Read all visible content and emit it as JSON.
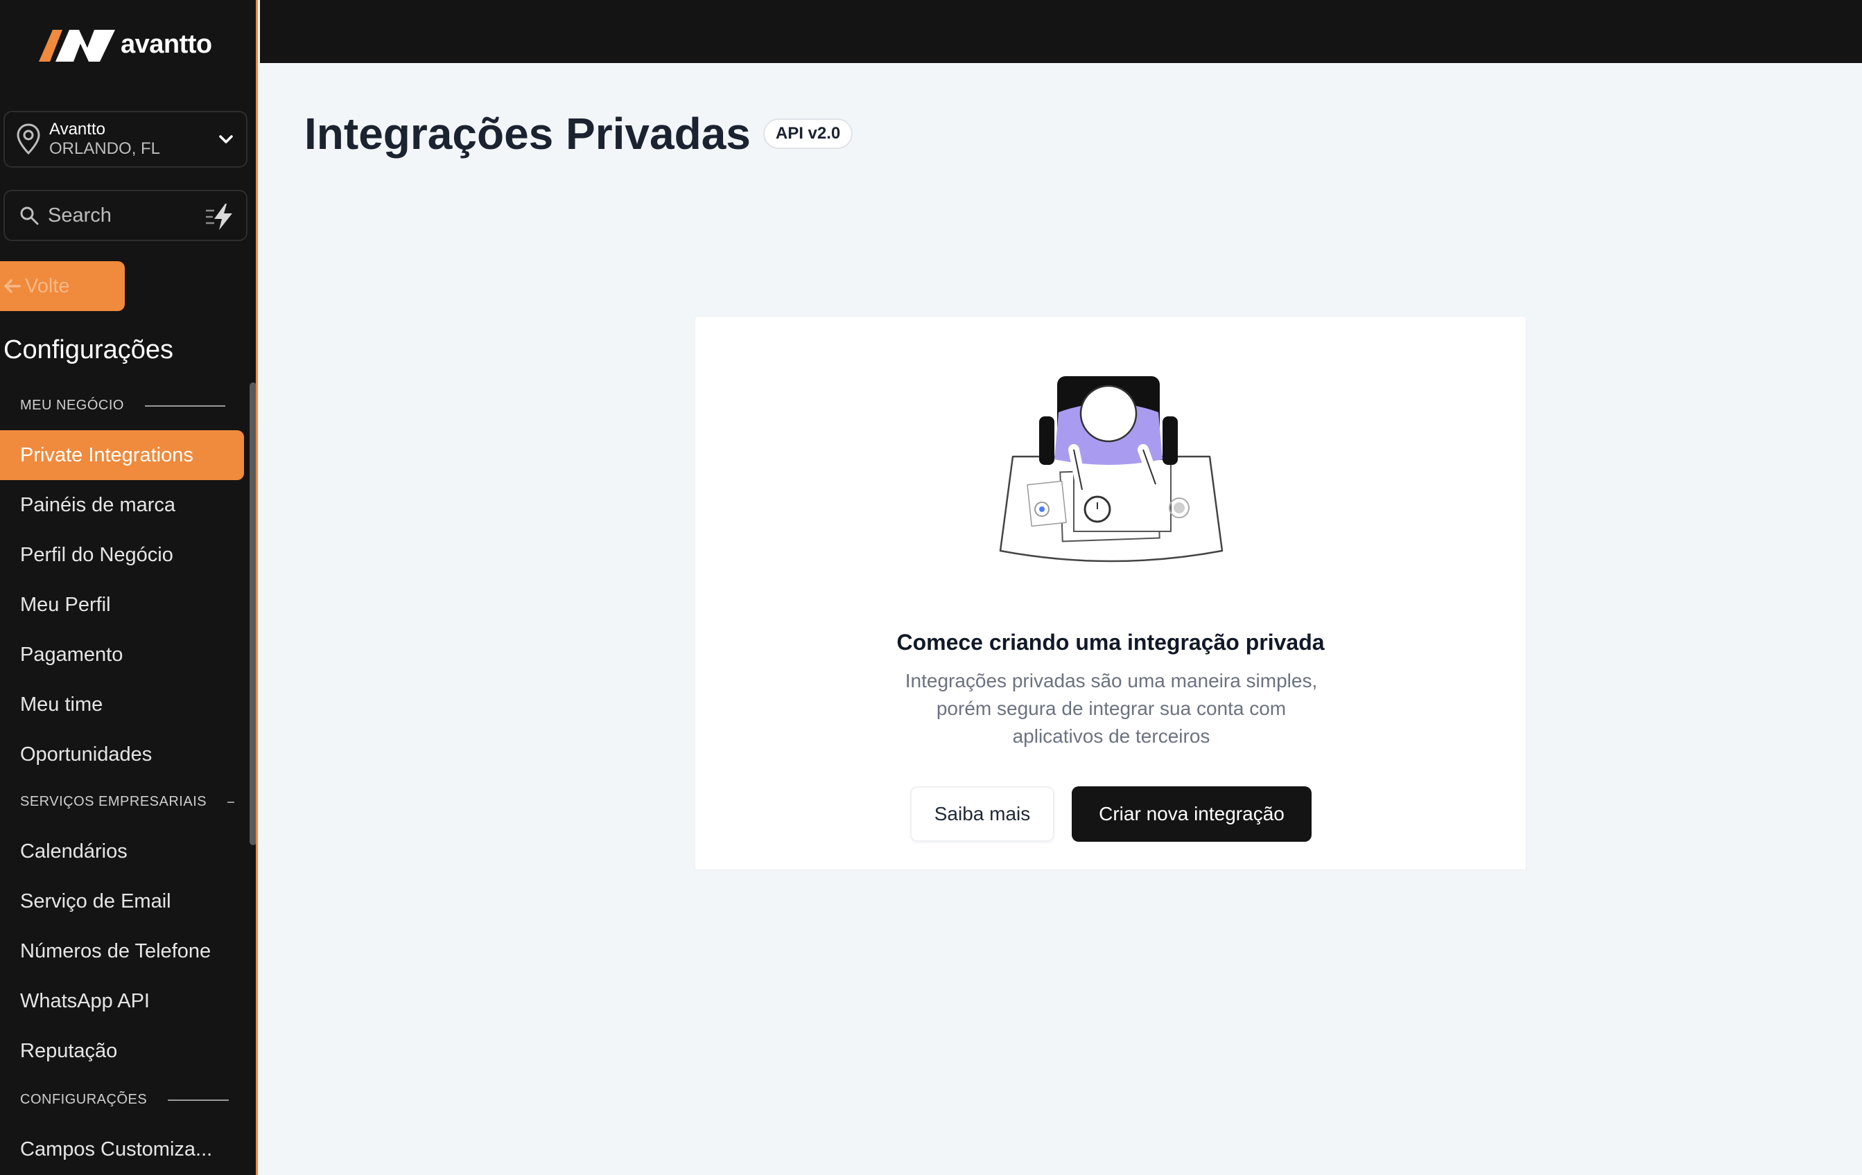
{
  "brand": {
    "logo_text": "avantto",
    "accent": "#f08a3c"
  },
  "location": {
    "name": "Avantto",
    "city": "ORLANDO, FL"
  },
  "search": {
    "placeholder": "Search"
  },
  "back_button": {
    "label": "Volte"
  },
  "sidebar": {
    "section_title": "Configurações",
    "groups": [
      {
        "label": "MEU NEGÓCIO",
        "items": [
          "Private Integrations",
          "Painéis de marca",
          "Perfil do Negócio",
          "Meu Perfil",
          "Pagamento",
          "Meu time",
          "Oportunidades"
        ]
      },
      {
        "label": "SERVIÇOS EMPRESARIAIS",
        "items": [
          "Calendários",
          "Serviço de Email",
          "Números de Telefone",
          "WhatsApp API",
          "Reputação"
        ]
      },
      {
        "label": "CONFIGURAÇÕES",
        "items": [
          "Campos Customiza..."
        ]
      }
    ],
    "active_item": "Private Integrations"
  },
  "main": {
    "title": "Integrações Privadas",
    "badge": "API v2.0",
    "empty_state": {
      "heading": "Comece criando uma integração privada",
      "description": "Integrações privadas são uma maneira simples, porém segura de integrar sua conta com aplicativos de terceiros",
      "secondary_button": "Saiba mais",
      "primary_button": "Criar nova integração"
    }
  }
}
